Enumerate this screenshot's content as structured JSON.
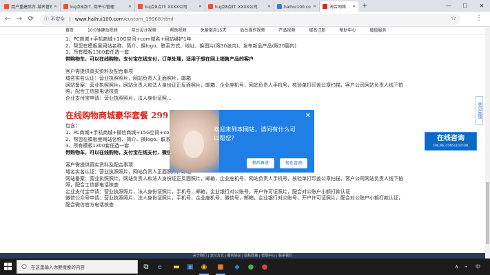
{
  "browser": {
    "tabs": [
      {
        "title": "用户重建后台-域名管理",
        "favicon_color": "#e8542e",
        "active": false
      },
      {
        "title": "kuj点8点IT, 商平公管理",
        "favicon_color": "#e8542e",
        "active": false
      },
      {
        "title": "kuj点8点IT: XXXX公司",
        "favicon_color": "#e8542e",
        "active": false
      },
      {
        "title": "kuj点8点IT: XXXX公司",
        "favicon_color": "#e8542e",
        "active": false
      },
      {
        "title": "haihui100.com_百度搜索",
        "favicon_color": "#3b78e7",
        "active": false
      },
      {
        "title": "海合网络",
        "favicon_color": "#d9281c",
        "active": true
      }
    ],
    "new_tab": "+",
    "window_controls": {
      "minimize": "—",
      "maximize": "☐",
      "close": "✕"
    },
    "nav": {
      "back": "←",
      "forward": "→",
      "reload": "⟳"
    },
    "address": {
      "security": "ⓘ 不安全",
      "separator": "|",
      "host": "www.haihui100.com",
      "path": "/custom_19968.html"
    },
    "bookmark_icon": "☆",
    "menu_icon": "⋮"
  },
  "site_nav": [
    "首页",
    "10分钟建站视频",
    "前台设计视频",
    "帮助视频",
    "免备案月15天",
    "后台操作视频",
    "产品视频",
    "域名注册",
    "帮助中心",
    "增值服务"
  ],
  "content": {
    "block1": [
      {
        "text": "1、PC商城+手机商城+10G空间+com域名+网站维护1年",
        "bold": false
      },
      {
        "text": "2、帮您在模板里网站名称、简介、换logo、联系方式、地址、换图片(限30张内)、发布新品产品(限20篇内)",
        "bold": false
      },
      {
        "text": "3、所有模板1300套任选一套",
        "bold": false
      },
      {
        "text": "带购物车，可以在线购物，支付宝在线支付，订单处理，适用于想在网上销售产品的客户",
        "bold": true
      }
    ],
    "block2": [
      {
        "text": "客户需提供真实资料及配合事项",
        "bold": false
      },
      {
        "text": "域名实名认证：营业执照照片，网站负责人正面照片，邮箱",
        "bold": false
      },
      {
        "text": "网站备案：营业执照照片，网站负责人和法人身份证正反面照片，邮箱，企业座机号，网站负责人手机号，核验单打印盖公章扫描，客户公司网站负责人线下拍",
        "bold": false
      },
      {
        "text": "照，配合工信部电话核查",
        "bold": false
      },
      {
        "text": "企业支付宝申请：营业执照照片，法人身份证照...",
        "bold": false
      }
    ],
    "package_title": "在线购物商城豪华套餐 299",
    "block3": [
      {
        "text": "包含：",
        "bold": false
      },
      {
        "text": "1、PC商城+手机商城+微信商城+15G空间+com域名...",
        "bold": false
      },
      {
        "text": "2、帮您在模板里网站名称、简介、换logo、联系...",
        "bold": false
      },
      {
        "text": "3、所有模板1300套任选一套",
        "bold": false
      },
      {
        "text": "带购物车，可以在线购物，支付宝在线支付，微信在线支付，订单处理，适用于想在网上销售产品的客户",
        "bold": true
      }
    ],
    "block4": [
      {
        "text": "客户需提供真实资料及配合事项",
        "bold": false
      },
      {
        "text": "域名实名认证：营业执照照片，网站负责人正面照片，邮箱",
        "bold": false
      },
      {
        "text": "网站备案：营业执照照片，网站负责人和法人身份证正反面照片，邮箱，企业座机号，网站负责人手机号，核验单打印盖公章扫描，客户公司网站负责人线下拍",
        "bold": false
      },
      {
        "text": "照，配合工信部电话核查",
        "bold": false
      },
      {
        "text": "企业支付宝申请：营业执照照片，法人身份证照片，手机号，邮箱，企业银行对公账号，开户许可证照片，配合对公账户小额打款认证",
        "bold": false
      },
      {
        "text": "微信公众号申请：营业执照照片，法人身份证照片，手机号，企业座机号，微信号，邮箱，企业银行对公账号，开户许可证照片，配合对公账户小额打款认证，",
        "bold": false
      },
      {
        "text": "配合微信官方电话核查",
        "bold": false
      }
    ]
  },
  "popup": {
    "message_line1": "欢迎来到本网站，请问有什么可",
    "message_line2": "以帮您？",
    "close": "✕",
    "later_button": "稍后再说",
    "consult_button": "现在咨询"
  },
  "consult_widget": {
    "title": "在线咨询",
    "subtitle": "ONLINE CONSULTATION"
  },
  "side_feedback": "意见反馈",
  "footer_text": "关于我们 | 支付方式 | 服务协议 | 隐私政策 | 帮助中心 | 联系我们",
  "taskbar": {
    "search_placeholder": "在这里输入你要搜索的内容",
    "search_icon": "○",
    "apps": [
      {
        "name": "task-view-icon",
        "glyph": "⧉",
        "color": "#ffffff"
      },
      {
        "name": "edge-icon",
        "glyph": "e",
        "color": "#3c8ee5"
      },
      {
        "name": "chrome-icon",
        "glyph": "◉",
        "color": "#f4c20d"
      },
      {
        "name": "file-explorer-icon",
        "glyph": "▬",
        "color": "#f4c542"
      },
      {
        "name": "app-orange-icon",
        "glyph": "■",
        "color": "#e07a2e"
      },
      {
        "name": "store-icon",
        "glyph": "▣",
        "color": "#5aa0e8"
      },
      {
        "name": "app-blue-icon",
        "glyph": "◆",
        "color": "#2d7bd6"
      },
      {
        "name": "app-green-icon",
        "glyph": "●",
        "color": "#43b049"
      },
      {
        "name": "app-red-icon",
        "glyph": "●",
        "color": "#e0433b"
      }
    ],
    "tray": {
      "up_arrow": "∧",
      "network": "⌁",
      "ime": "中"
    }
  }
}
